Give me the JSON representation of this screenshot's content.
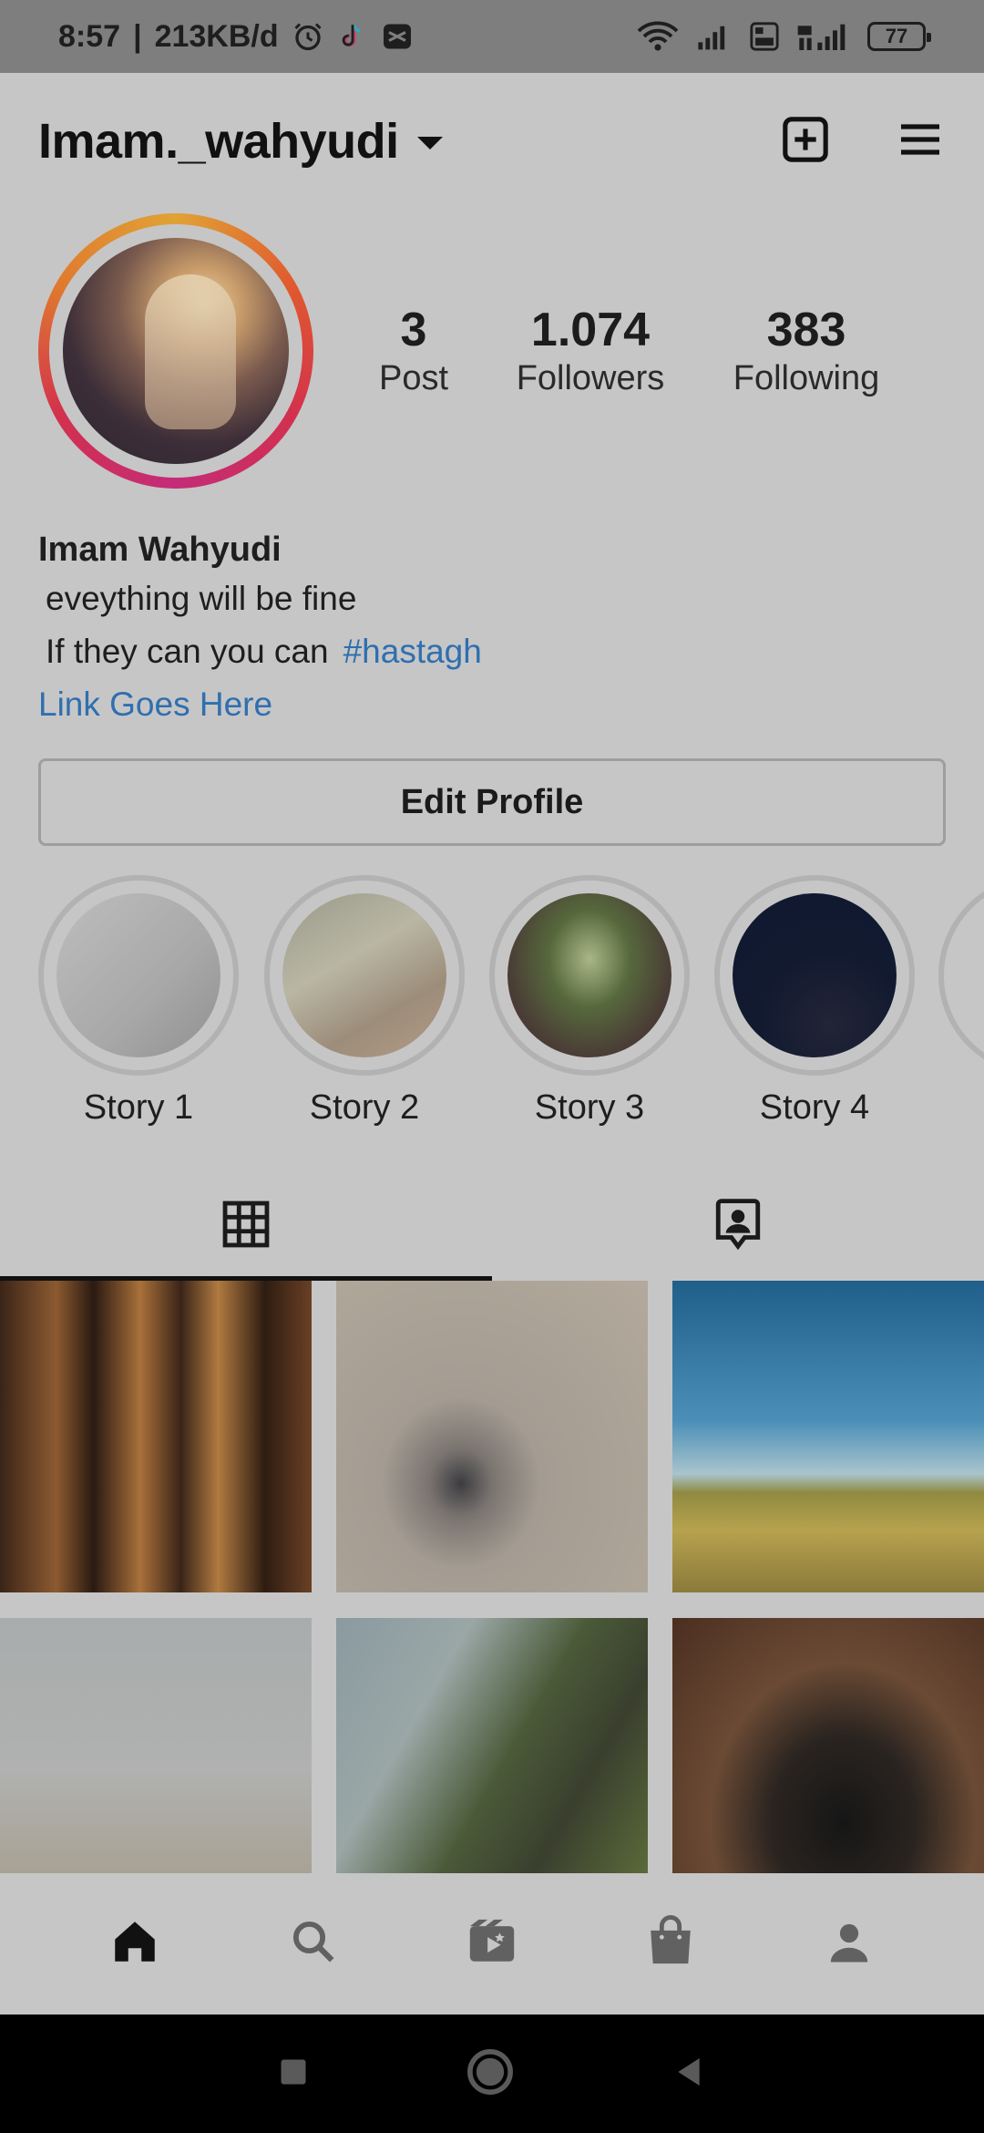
{
  "status_bar": {
    "time": "8:57",
    "separator": "|",
    "data_rate": "213KB/d",
    "battery": "77",
    "icons": [
      "alarm-icon",
      "tiktok-icon",
      "capcut-icon",
      "wifi-icon",
      "signal-icon",
      "volte-icon",
      "signal-4g-icon",
      "battery-icon"
    ]
  },
  "header": {
    "username": "Imam._wahyudi",
    "icons": [
      "chevron-down-icon",
      "new-post-icon",
      "menu-icon"
    ]
  },
  "stats": [
    {
      "value": "3",
      "label": "Post"
    },
    {
      "value": "1.074",
      "label": "Followers"
    },
    {
      "value": "383",
      "label": "Following"
    }
  ],
  "bio": {
    "name": "Imam Wahyudi",
    "line1": "eveything will be fine",
    "line2": "If they can you can",
    "hashtag": "#hastagh",
    "link": "Link Goes Here"
  },
  "edit_profile_label": "Edit Profile",
  "highlights": [
    {
      "label": "Story 1"
    },
    {
      "label": "Story 2"
    },
    {
      "label": "Story 3"
    },
    {
      "label": "Story 4"
    }
  ],
  "tabs": [
    "grid-icon",
    "tagged-icon"
  ],
  "bottom_nav": [
    "home-icon",
    "search-icon",
    "reels-icon",
    "shop-icon",
    "profile-icon"
  ],
  "colors": {
    "link": "#2f6fb0",
    "status_bar_bg": "#7e7e7e",
    "page_bg": "#c6c6c6"
  }
}
